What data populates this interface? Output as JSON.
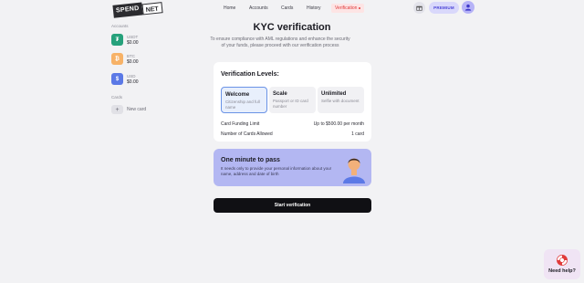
{
  "brand": {
    "logo_part1": "SPEND",
    "logo_part2": "NET"
  },
  "nav": {
    "items": [
      {
        "label": "Home"
      },
      {
        "label": "Accounts"
      },
      {
        "label": "Cards"
      },
      {
        "label": "History"
      },
      {
        "label": "Verification"
      }
    ],
    "active_index": 4,
    "premium_label": "PREMIUM"
  },
  "sidebar": {
    "accounts_title": "Accounts",
    "accounts": [
      {
        "name": "USDT",
        "balance": "$0.00",
        "icon": "tether-icon",
        "color": "#26a17b",
        "glyph": "₮"
      },
      {
        "name": "BTC",
        "balance": "$0.00",
        "icon": "bitcoin-icon",
        "color": "#f7b267",
        "glyph": "₿"
      },
      {
        "name": "USD",
        "balance": "$0.00",
        "icon": "dollar-icon",
        "color": "#5b79e6",
        "glyph": "$"
      }
    ],
    "cards_title": "Cards",
    "new_card_label": "New card"
  },
  "main": {
    "title": "KYC verification",
    "subtitle": "To ensure compliance with AML regulations and enhance the security of your funds, please proceed with our verification process",
    "levels": {
      "title": "Verification Levels:",
      "items": [
        {
          "name": "Welcome",
          "desc": "Citizenship and full name",
          "selected": true
        },
        {
          "name": "Scale",
          "desc": "Passport or ID card number",
          "selected": false
        },
        {
          "name": "Unlimited",
          "desc": "Selfie with document",
          "selected": false
        }
      ],
      "info": [
        {
          "label": "Card Funding Limit",
          "value": "Up to $500.00 per month"
        },
        {
          "label": "Number of Cards Allowed",
          "value": "1 card"
        }
      ]
    },
    "banner": {
      "title": "One minute to pass",
      "text": "It needs only to provide your personal information about your name, address and date of birth",
      "icon": "person-icon"
    },
    "start_button": "Start verification"
  },
  "help": {
    "label": "Need help?",
    "icon": "lifebuoy-icon"
  },
  "colors": {
    "accent": "#4b44d6",
    "active_nav": "#e03b3b",
    "banner": "#b3b7f2",
    "button": "#101014"
  }
}
